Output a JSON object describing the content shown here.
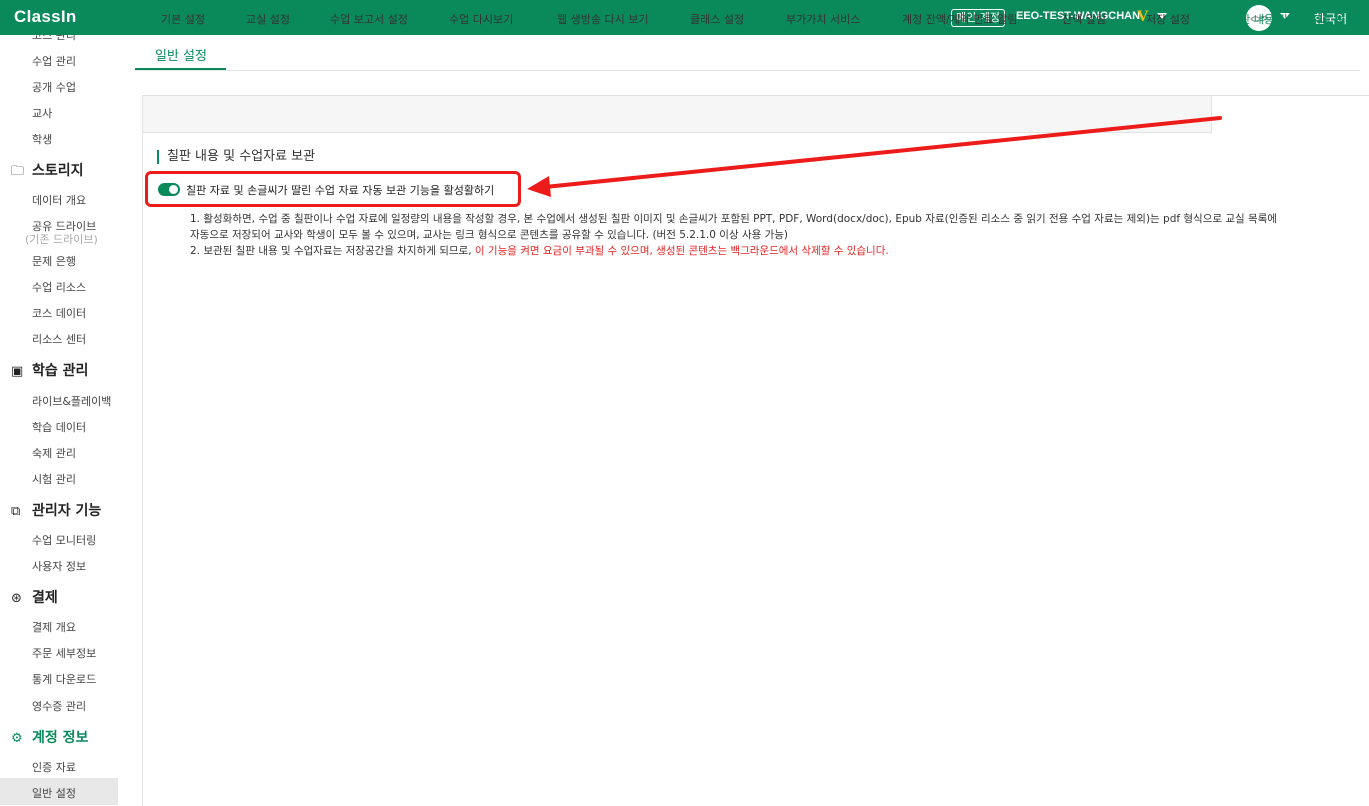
{
  "topbar": {
    "logo": "ClassIn",
    "main_account_badge": "메인 계정",
    "account_name": "EEO-TEST-WANGCHAN",
    "vip_mark": "V",
    "language": "한국어",
    "bg_color": "#0a8a5b"
  },
  "sidebar": {
    "items_top": [
      {
        "label": "코스 관리"
      },
      {
        "label": "수업 관리"
      },
      {
        "label": "공개 수업"
      },
      {
        "label": "교사"
      },
      {
        "label": "학생"
      }
    ],
    "story": {
      "title": "스토리지",
      "icon": "folder-icon",
      "items": [
        {
          "label": "데이터 개요"
        },
        {
          "label": "공유 드라이브"
        },
        {
          "label": "(기존 드라이브)"
        },
        {
          "label": "문제 은행"
        },
        {
          "label": "수업 리소스"
        },
        {
          "label": "코스 데이터"
        },
        {
          "label": "리소스 센터"
        }
      ]
    },
    "learning": {
      "title": "학습 관리",
      "icon": "id-card-icon",
      "items": [
        {
          "label": "라이브&플레이백"
        },
        {
          "label": "학습 데이터"
        },
        {
          "label": "숙제 관리"
        },
        {
          "label": "시험 관리"
        }
      ]
    },
    "admin": {
      "title": "관리자 기능",
      "icon": "admin-icon",
      "items": [
        {
          "label": "수업 모니터링"
        },
        {
          "label": "사용자 정보"
        }
      ]
    },
    "payment": {
      "title": "결제",
      "icon": "yen-icon",
      "items": [
        {
          "label": "결제 개요"
        },
        {
          "label": "주문 세부정보"
        },
        {
          "label": "통계 다운로드"
        },
        {
          "label": "영수증 관리"
        }
      ]
    },
    "account": {
      "title": "계정 정보",
      "icon": "gear-icon",
      "items": [
        {
          "label": "인증 자료"
        },
        {
          "label": "일반 설정"
        }
      ]
    }
  },
  "main": {
    "top_tab": "일반 설정",
    "sub_tabs": [
      {
        "label": "기본 설정"
      },
      {
        "label": "교실 설정"
      },
      {
        "label": "수업 보고서 설정"
      },
      {
        "label": "수업 다시보기"
      },
      {
        "label": "웹 생방송 다시 보기"
      },
      {
        "label": "클래스 설정"
      },
      {
        "label": "부가가치 서비스"
      },
      {
        "label": "계정 잔액/계약 만료 알림"
      },
      {
        "label": "잔액 알림"
      },
      {
        "label": "저장 설정"
      },
      {
        "label": "칠판 내용 및 수업자료 보관"
      }
    ],
    "section_title": "칠판 내용 및 수업자료 보관",
    "toggle": {
      "label": "칠판 자료 및 손글씨가 딸린 수업 자료 자동 보관 기능을 활성활하기",
      "on": true
    },
    "notes": {
      "line1": "1. 활성화하면, 수업 중 칠판이나 수업 자료에 일정량의 내용을 작성할 경우, 본 수업에서 생성된 칠판 이미지 및 손글씨가 포함된 PPT, PDF, Word(docx/doc), Epub 자료(인증된 리소스 중 읽기 전용 수업 자료는 제외)는 pdf 형식으로 교실 목록에",
      "line2": "자동으로 저장되어 교사와 학생이 모두 볼 수 있으며, 교사는 링크 형식으로 콘텐츠를 공유할 수 있습니다. (버전 5.2.1.0 이상 사용 가능)",
      "line3_normal": "2. 보관된 칠판 내용 및 수업자료는 저장공간을 차지하게 되므로, ",
      "line3_warn": "이 기능을 켜면 요금이 부과될 수 있으며, 생성된 콘텐츠는 백그라운드에서 삭제할 수 있습니다."
    }
  }
}
